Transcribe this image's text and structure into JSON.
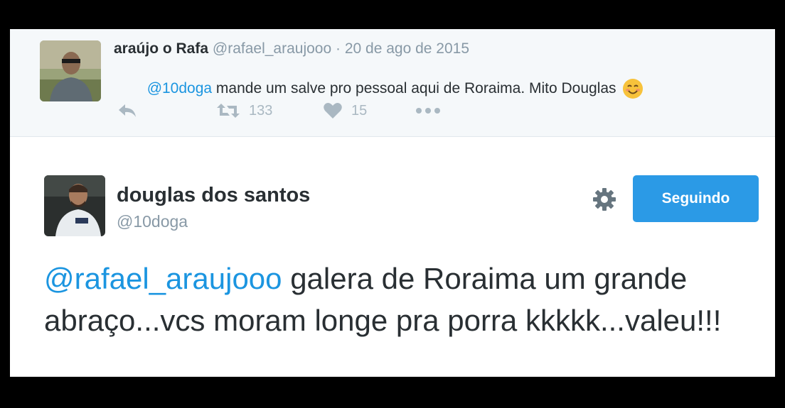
{
  "parent_tweet": {
    "author_name": "araújo o Rafa",
    "author_handle": "@rafael_araujooo",
    "separator": "·",
    "date": "20 de ago de 2015",
    "mention": "@10doga",
    "text": " mande um salve pro pessoal aqui de Roraima. Mito Douglas",
    "emoji": "smiling-face-icon",
    "retweet_count": "133",
    "like_count": "15"
  },
  "main_tweet": {
    "author_name": "douglas dos santos",
    "author_handle": "@10doga",
    "follow_label": "Seguindo",
    "mention": "@rafael_araujooo",
    "text": " galera de Roraima um grande abraço...vcs moram longe pra porra kkkkk...valeu!!!"
  },
  "colors": {
    "link": "#1b95e0",
    "button": "#2b9ae6",
    "muted": "#8899a6",
    "text": "#292f33"
  }
}
